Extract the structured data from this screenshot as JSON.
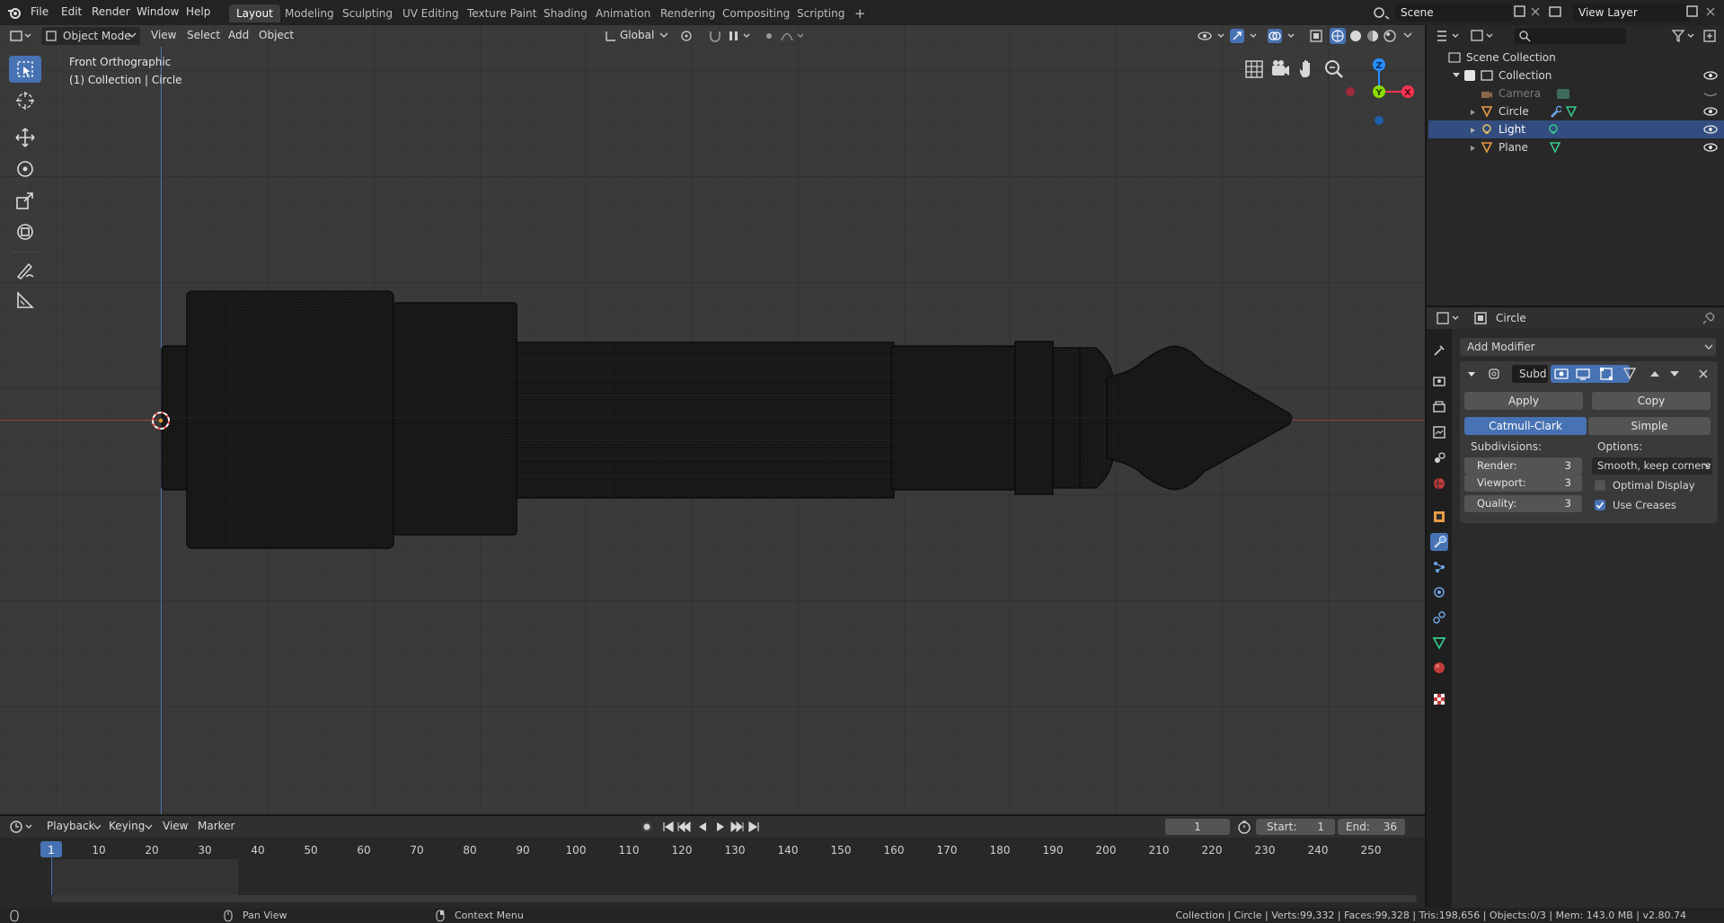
{
  "topbar": {
    "menus": [
      "File",
      "Edit",
      "Render",
      "Window",
      "Help"
    ],
    "workspaces": [
      "Layout",
      "Modeling",
      "Sculpting",
      "UV Editing",
      "Texture Paint",
      "Shading",
      "Animation",
      "Rendering",
      "Compositing",
      "Scripting"
    ],
    "active_workspace": "Layout",
    "add_workspace": "+",
    "scene": "Scene",
    "view_layer": "View Layer"
  },
  "viewport": {
    "mode": "Object Mode",
    "menus": [
      "View",
      "Select",
      "Add",
      "Object"
    ],
    "orientation": "Global",
    "view_name": "Front Orthographic",
    "collection_info": "(1) Collection | Circle",
    "gizmo": {
      "z": "Z",
      "y": "Y",
      "x": "X"
    }
  },
  "outliner": {
    "root": "Scene Collection",
    "collection": "Collection",
    "items": [
      {
        "name": "Camera",
        "selected": false,
        "dim": true
      },
      {
        "name": "Circle",
        "selected": false,
        "dim": false
      },
      {
        "name": "Light",
        "selected": true,
        "dim": false
      },
      {
        "name": "Plane",
        "selected": false,
        "dim": false
      }
    ]
  },
  "properties": {
    "object_name": "Circle",
    "add_modifier": "Add Modifier",
    "modifier_name": "Subd",
    "apply": "Apply",
    "copy": "Copy",
    "catmull": "Catmull-Clark",
    "simple": "Simple",
    "subdivisions": "Subdivisions:",
    "options": "Options:",
    "render_label": "Render:",
    "render_val": "3",
    "viewport_label": "Viewport:",
    "viewport_val": "3",
    "quality_label": "Quality:",
    "quality_val": "3",
    "uv_smooth": "Smooth, keep corners",
    "optimal_display": "Optimal Display",
    "optimal_display_checked": false,
    "use_creases": "Use Creases",
    "use_creases_checked": true
  },
  "timeline": {
    "menus": [
      "Playback",
      "Keying",
      "View",
      "Marker"
    ],
    "current_frame": "1",
    "start_label": "Start:",
    "start": "1",
    "end_label": "End:",
    "end": "36",
    "ruler": [
      "1",
      "10",
      "20",
      "30",
      "40",
      "50",
      "60",
      "70",
      "80",
      "90",
      "100",
      "110",
      "120",
      "130",
      "140",
      "150",
      "160",
      "170",
      "180",
      "190",
      "200",
      "210",
      "220",
      "230",
      "240",
      "250"
    ]
  },
  "statusbar": {
    "pan": "Pan View",
    "context": "Context Menu",
    "stats": "Collection | Circle | Verts:99,332 | Faces:99,328 | Tris:198,656 | Objects:0/3 | Mem: 143.0 MB | v2.80.74"
  },
  "colors": {
    "accent": "#4772b3",
    "axis_x": "#ff3352",
    "axis_y": "#8bdc00",
    "axis_z": "#2890ff",
    "bg": "#303030"
  }
}
